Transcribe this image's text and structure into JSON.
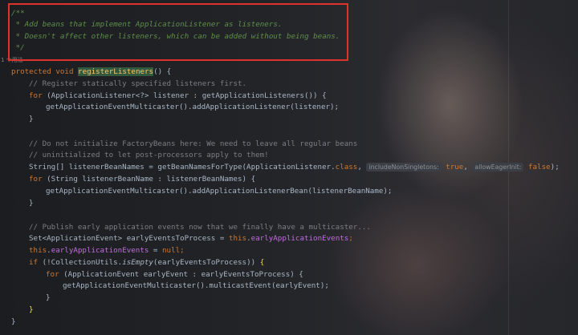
{
  "doc_comment": {
    "line1": "/**",
    "line2": " * Add beans that implement ApplicationListener as listeners.",
    "line3": " * Doesn't affect other listeners, which can be added without being beans.",
    "line4": " */"
  },
  "usage_hint": "1 个用法",
  "code": {
    "sig_protected": "protected",
    "sig_void": "void",
    "sig_method": "registerListeners",
    "sig_tail": "() {",
    "c1": "// Register statically specified listeners first.",
    "for1_kw": "for",
    "for1_rest": " (ApplicationListener<?> listener : getApplicationListeners()) {",
    "l_add": "getApplicationEventMulticaster().addApplicationListener(listener);",
    "close_brace": "}",
    "c2": "// Do not initialize FactoryBeans here: We need to leave all regular beans",
    "c3": "// uninitialized to let post-processors apply to them!",
    "arr_decl": "String[] listenerBeanNames = getBeanNamesForType(ApplicationListener.",
    "arr_class": "class",
    "hint1": "includeNonSingletons:",
    "val_true": "true",
    "hint2": "allowEagerInit:",
    "val_false": "false",
    "arr_end": ");",
    "for2_kw": "for",
    "for2_rest": " (String listenerBeanName : listenerBeanNames) {",
    "l_addbean": "getApplicationEventMulticaster().addApplicationListenerBean(listenerBeanName);",
    "c4": "// Publish early application events now that we finally have a multicaster...",
    "set_decl": "Set<ApplicationEvent> earlyEventsToProcess = ",
    "this_kw": "this",
    "early_field": "earlyApplicationEvents",
    "semicolon": ";",
    "assign_null_tail": " = ",
    "null_kw": "null",
    "if_kw": "if",
    "if_pre": " (!CollectionUtils.",
    "if_method": "isEmpty",
    "if_post": "(earlyEventsToProcess)) ",
    "open_brace": "{",
    "for3_kw": "for",
    "for3_rest": " (ApplicationEvent earlyEvent : earlyEventsToProcess) {",
    "l_multicast": "getApplicationEventMulticaster().multicastEvent(earlyEvent);",
    "dot": "."
  },
  "colors": {
    "keyword": "#cc7832",
    "comment": "#7a7e85",
    "doc_comment": "#5f8f4a",
    "field": "#c06ddb",
    "method_highlight": "#ffc66d",
    "annotation_box": "#e0312b"
  }
}
